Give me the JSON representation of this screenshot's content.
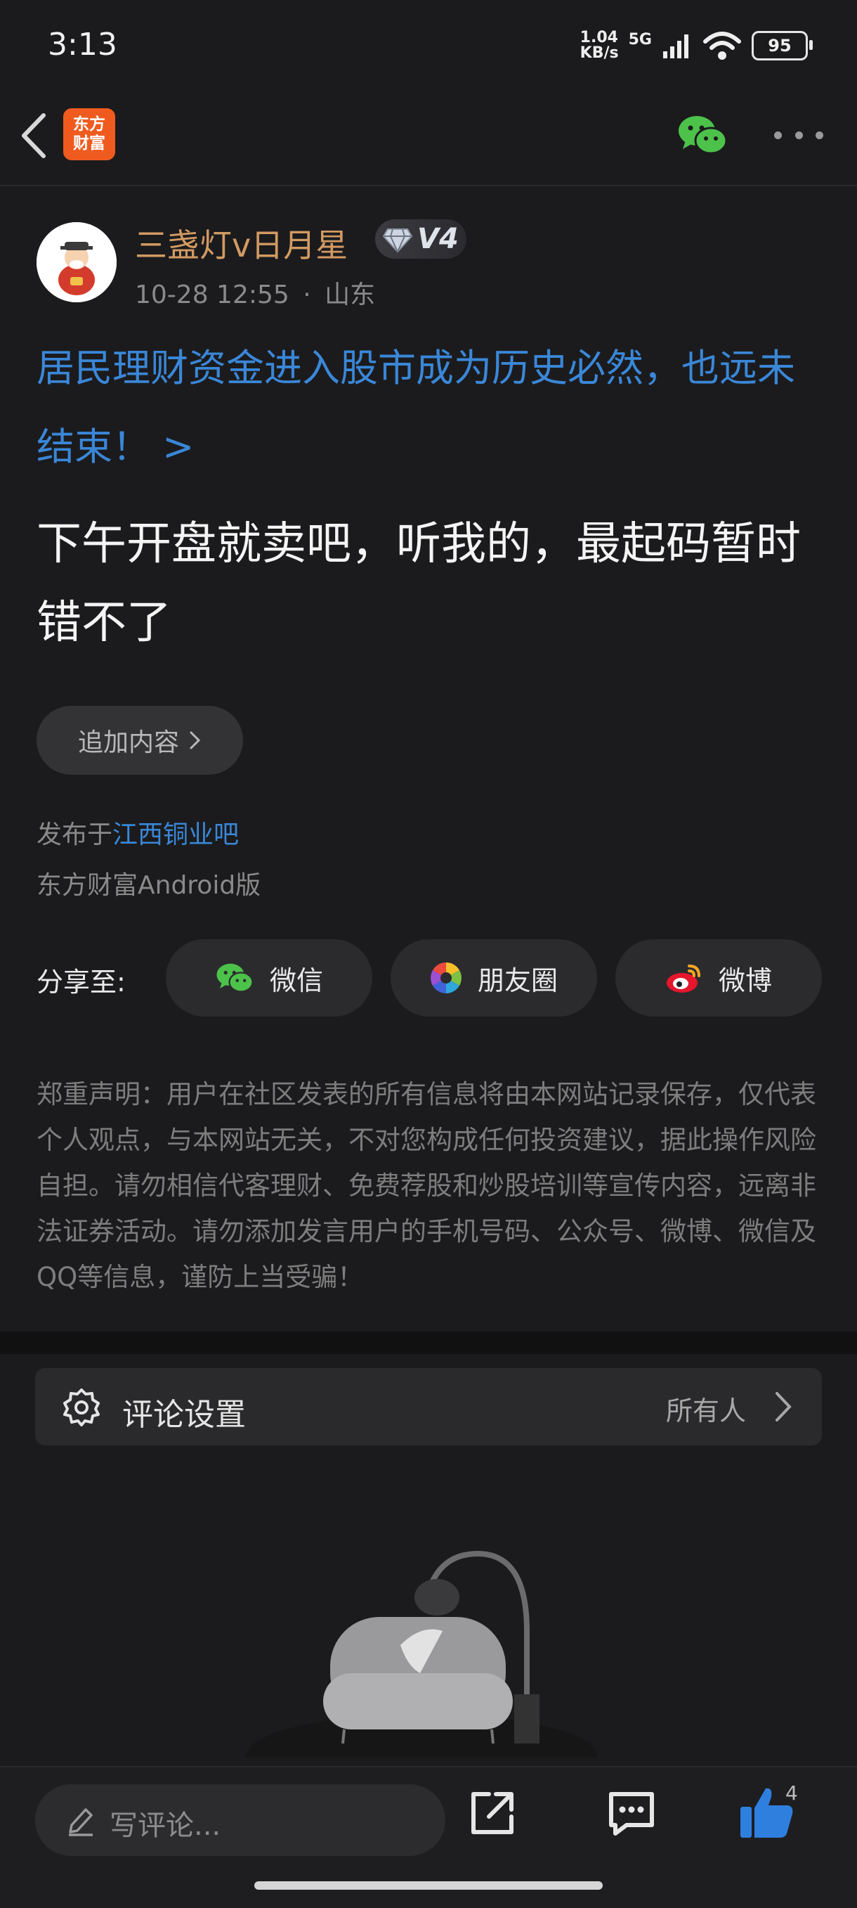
{
  "status_bar": {
    "time": "3:13",
    "net_speed_value": "1.04",
    "net_speed_unit": "KB/s",
    "network": "5G",
    "battery": "95"
  },
  "header": {
    "logo_line1": "东方",
    "logo_line2": "财富"
  },
  "post": {
    "author": "三盏灯v日月星",
    "vip_level": "V4",
    "timestamp": "10-28 12:55",
    "meta_separator": "·",
    "location": "山东",
    "title": "居民理财资金进入股市成为历史必然，也远未结束！ >",
    "body": "下午开盘就卖吧，听我的，最起码暂时错不了",
    "append_label": "追加内容",
    "published_prefix": "发布于",
    "forum": "江西铜业吧",
    "client": "东方财富Android版"
  },
  "share": {
    "label": "分享至:",
    "wechat": "微信",
    "moments": "朋友圈",
    "weibo": "微博"
  },
  "disclaimer": "郑重声明：用户在社区发表的所有信息将由本网站记录保存，仅代表个人观点，与本网站无关，不对您构成任何投资建议，据此操作风险自担。请勿相信代客理财、免费荐股和炒股培训等宣传内容，远离非法证券活动。请勿添加发言用户的手机号码、公众号、微博、微信及QQ等信息，谨防上当受骗！",
  "comment_settings": {
    "label": "评论设置",
    "value": "所有人"
  },
  "bottom_bar": {
    "comment_placeholder": "写评论...",
    "like_count": "4"
  },
  "colors": {
    "background": "#1b1b1d",
    "link_blue": "#3a87d8",
    "author_orange": "#d29a62",
    "brand_orange": "#ef5b1f",
    "wechat_green": "#4cc24a"
  }
}
